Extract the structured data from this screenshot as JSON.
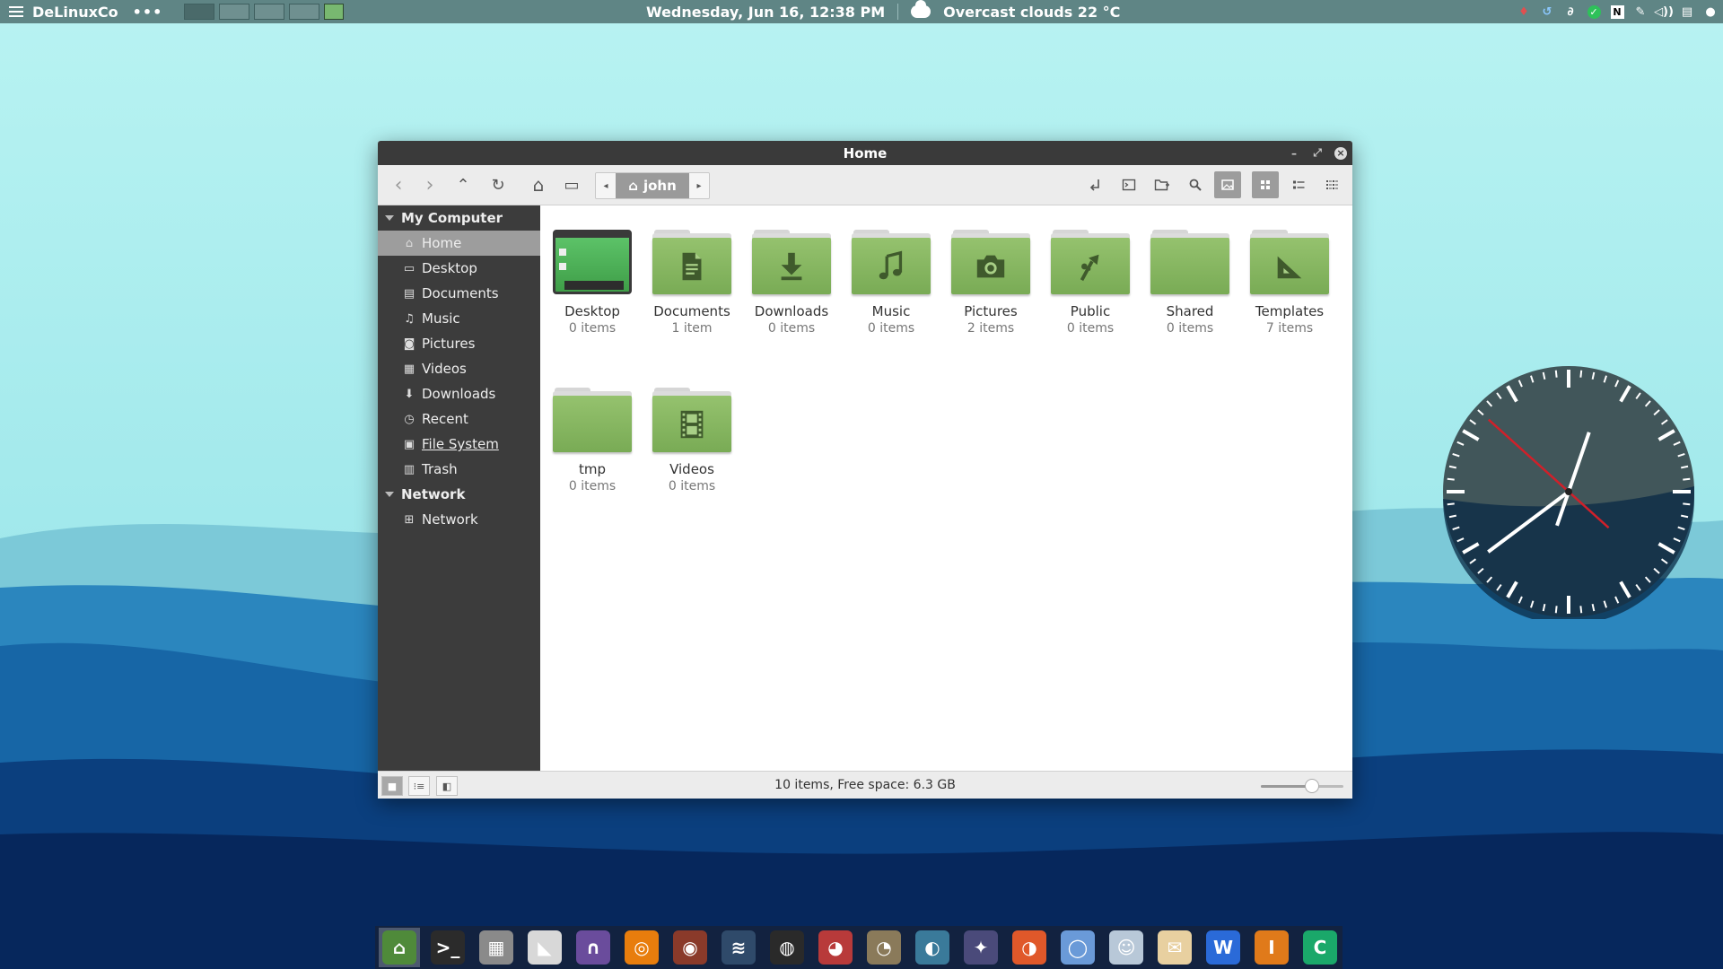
{
  "top_panel": {
    "brand": "DeLinuxCo",
    "dots": "•••",
    "datetime": "Wednesday, Jun 16, 12:38 PM",
    "weather": "Overcast clouds 22 °C",
    "workspaces": [
      "ws1",
      "ws2",
      "ws3",
      "ws4"
    ]
  },
  "window": {
    "title": "Home",
    "minimize_glyph": "–",
    "maximize_glyph": "⤢",
    "close_glyph": "×"
  },
  "toolbar": {
    "back": "‹",
    "forward": "›",
    "up": "⌃",
    "reload": "↻",
    "home": "⌂",
    "computer": "▭",
    "crumb_left": "◂",
    "crumb_right": "▸",
    "crumb_home_icon": "⌂",
    "crumb_label": "john"
  },
  "sidebar": {
    "sections": [
      {
        "title": "My Computer",
        "items": [
          {
            "label": "Home",
            "icon": "home-icon",
            "glyph": "⌂",
            "selected": true
          },
          {
            "label": "Desktop",
            "icon": "desktop-icon",
            "glyph": "▭"
          },
          {
            "label": "Documents",
            "icon": "document-icon",
            "glyph": "▤"
          },
          {
            "label": "Music",
            "icon": "music-icon",
            "glyph": "♫"
          },
          {
            "label": "Pictures",
            "icon": "camera-icon",
            "glyph": "◙"
          },
          {
            "label": "Videos",
            "icon": "film-icon",
            "glyph": "▦"
          },
          {
            "label": "Downloads",
            "icon": "download-icon",
            "glyph": "⬇"
          },
          {
            "label": "Recent",
            "icon": "clock-icon",
            "glyph": "◷"
          },
          {
            "label": "File System",
            "icon": "drive-icon",
            "glyph": "▣",
            "underline": true
          },
          {
            "label": "Trash",
            "icon": "trash-icon",
            "glyph": "▥"
          }
        ]
      },
      {
        "title": "Network",
        "items": [
          {
            "label": "Network",
            "icon": "network-icon",
            "glyph": "⊞"
          }
        ]
      }
    ]
  },
  "files": [
    {
      "name": "Desktop",
      "count": "0 items",
      "icon": "desktop-thumb"
    },
    {
      "name": "Documents",
      "count": "1 item",
      "icon": "document"
    },
    {
      "name": "Downloads",
      "count": "0 items",
      "icon": "download"
    },
    {
      "name": "Music",
      "count": "0 items",
      "icon": "music"
    },
    {
      "name": "Pictures",
      "count": "2 items",
      "icon": "camera"
    },
    {
      "name": "Public",
      "count": "0 items",
      "icon": "share"
    },
    {
      "name": "Shared",
      "count": "0 items",
      "icon": "plain"
    },
    {
      "name": "Templates",
      "count": "7 items",
      "icon": "template"
    },
    {
      "name": "tmp",
      "count": "0 items",
      "icon": "plain"
    },
    {
      "name": "Videos",
      "count": "0 items",
      "icon": "film"
    }
  ],
  "statusbar": {
    "text": "10 items, Free space: 6.3 GB",
    "zoom_fraction": 0.62
  },
  "clock": {
    "hour": 12,
    "minute": 38,
    "second": 52
  },
  "colors": {
    "folder_green": "#88b85f",
    "folder_symbol": "#3f5a2c",
    "sidebar_bg": "#3c3c3c",
    "selected_bg": "#9d9d9d",
    "panel_bg": "#5f8585"
  },
  "dock": [
    {
      "name": "home-folder",
      "bg": "#4f8a3a",
      "glyph": "⌂",
      "active": true
    },
    {
      "name": "terminal",
      "bg": "#2b2b2b",
      "glyph": ">_"
    },
    {
      "name": "calculator",
      "bg": "#8a8a8a",
      "glyph": "▦"
    },
    {
      "name": "draw",
      "bg": "#d8d8d8",
      "glyph": "◣"
    },
    {
      "name": "audio",
      "bg": "#6a4c9c",
      "glyph": "∩"
    },
    {
      "name": "blender",
      "bg": "#e87d0d",
      "glyph": "◎"
    },
    {
      "name": "video-editor",
      "bg": "#8a3a2a",
      "glyph": "◉"
    },
    {
      "name": "audio-editor",
      "bg": "#2f4a6a",
      "glyph": "≋"
    },
    {
      "name": "camera-app",
      "bg": "#2a2a2a",
      "glyph": "◍"
    },
    {
      "name": "color-app",
      "bg": "#b83a3a",
      "glyph": "◕"
    },
    {
      "name": "gimp",
      "bg": "#8a7a5a",
      "glyph": "◔"
    },
    {
      "name": "fish-app",
      "bg": "#3a7a9a",
      "glyph": "◐"
    },
    {
      "name": "bird-app",
      "bg": "#4a4a7a",
      "glyph": "✦"
    },
    {
      "name": "firefox",
      "bg": "#e0582a",
      "glyph": "◑"
    },
    {
      "name": "chromium",
      "bg": "#6a9ad8",
      "glyph": "◯"
    },
    {
      "name": "mail-app",
      "bg": "#b8c8d8",
      "glyph": "☺"
    },
    {
      "name": "stamp-app",
      "bg": "#e8d0a0",
      "glyph": "✉"
    },
    {
      "name": "writer",
      "bg": "#2a6ad8",
      "glyph": "W"
    },
    {
      "name": "impress",
      "bg": "#e07a1a",
      "glyph": "I"
    },
    {
      "name": "calc-sheet",
      "bg": "#1aa86a",
      "glyph": "C"
    }
  ]
}
